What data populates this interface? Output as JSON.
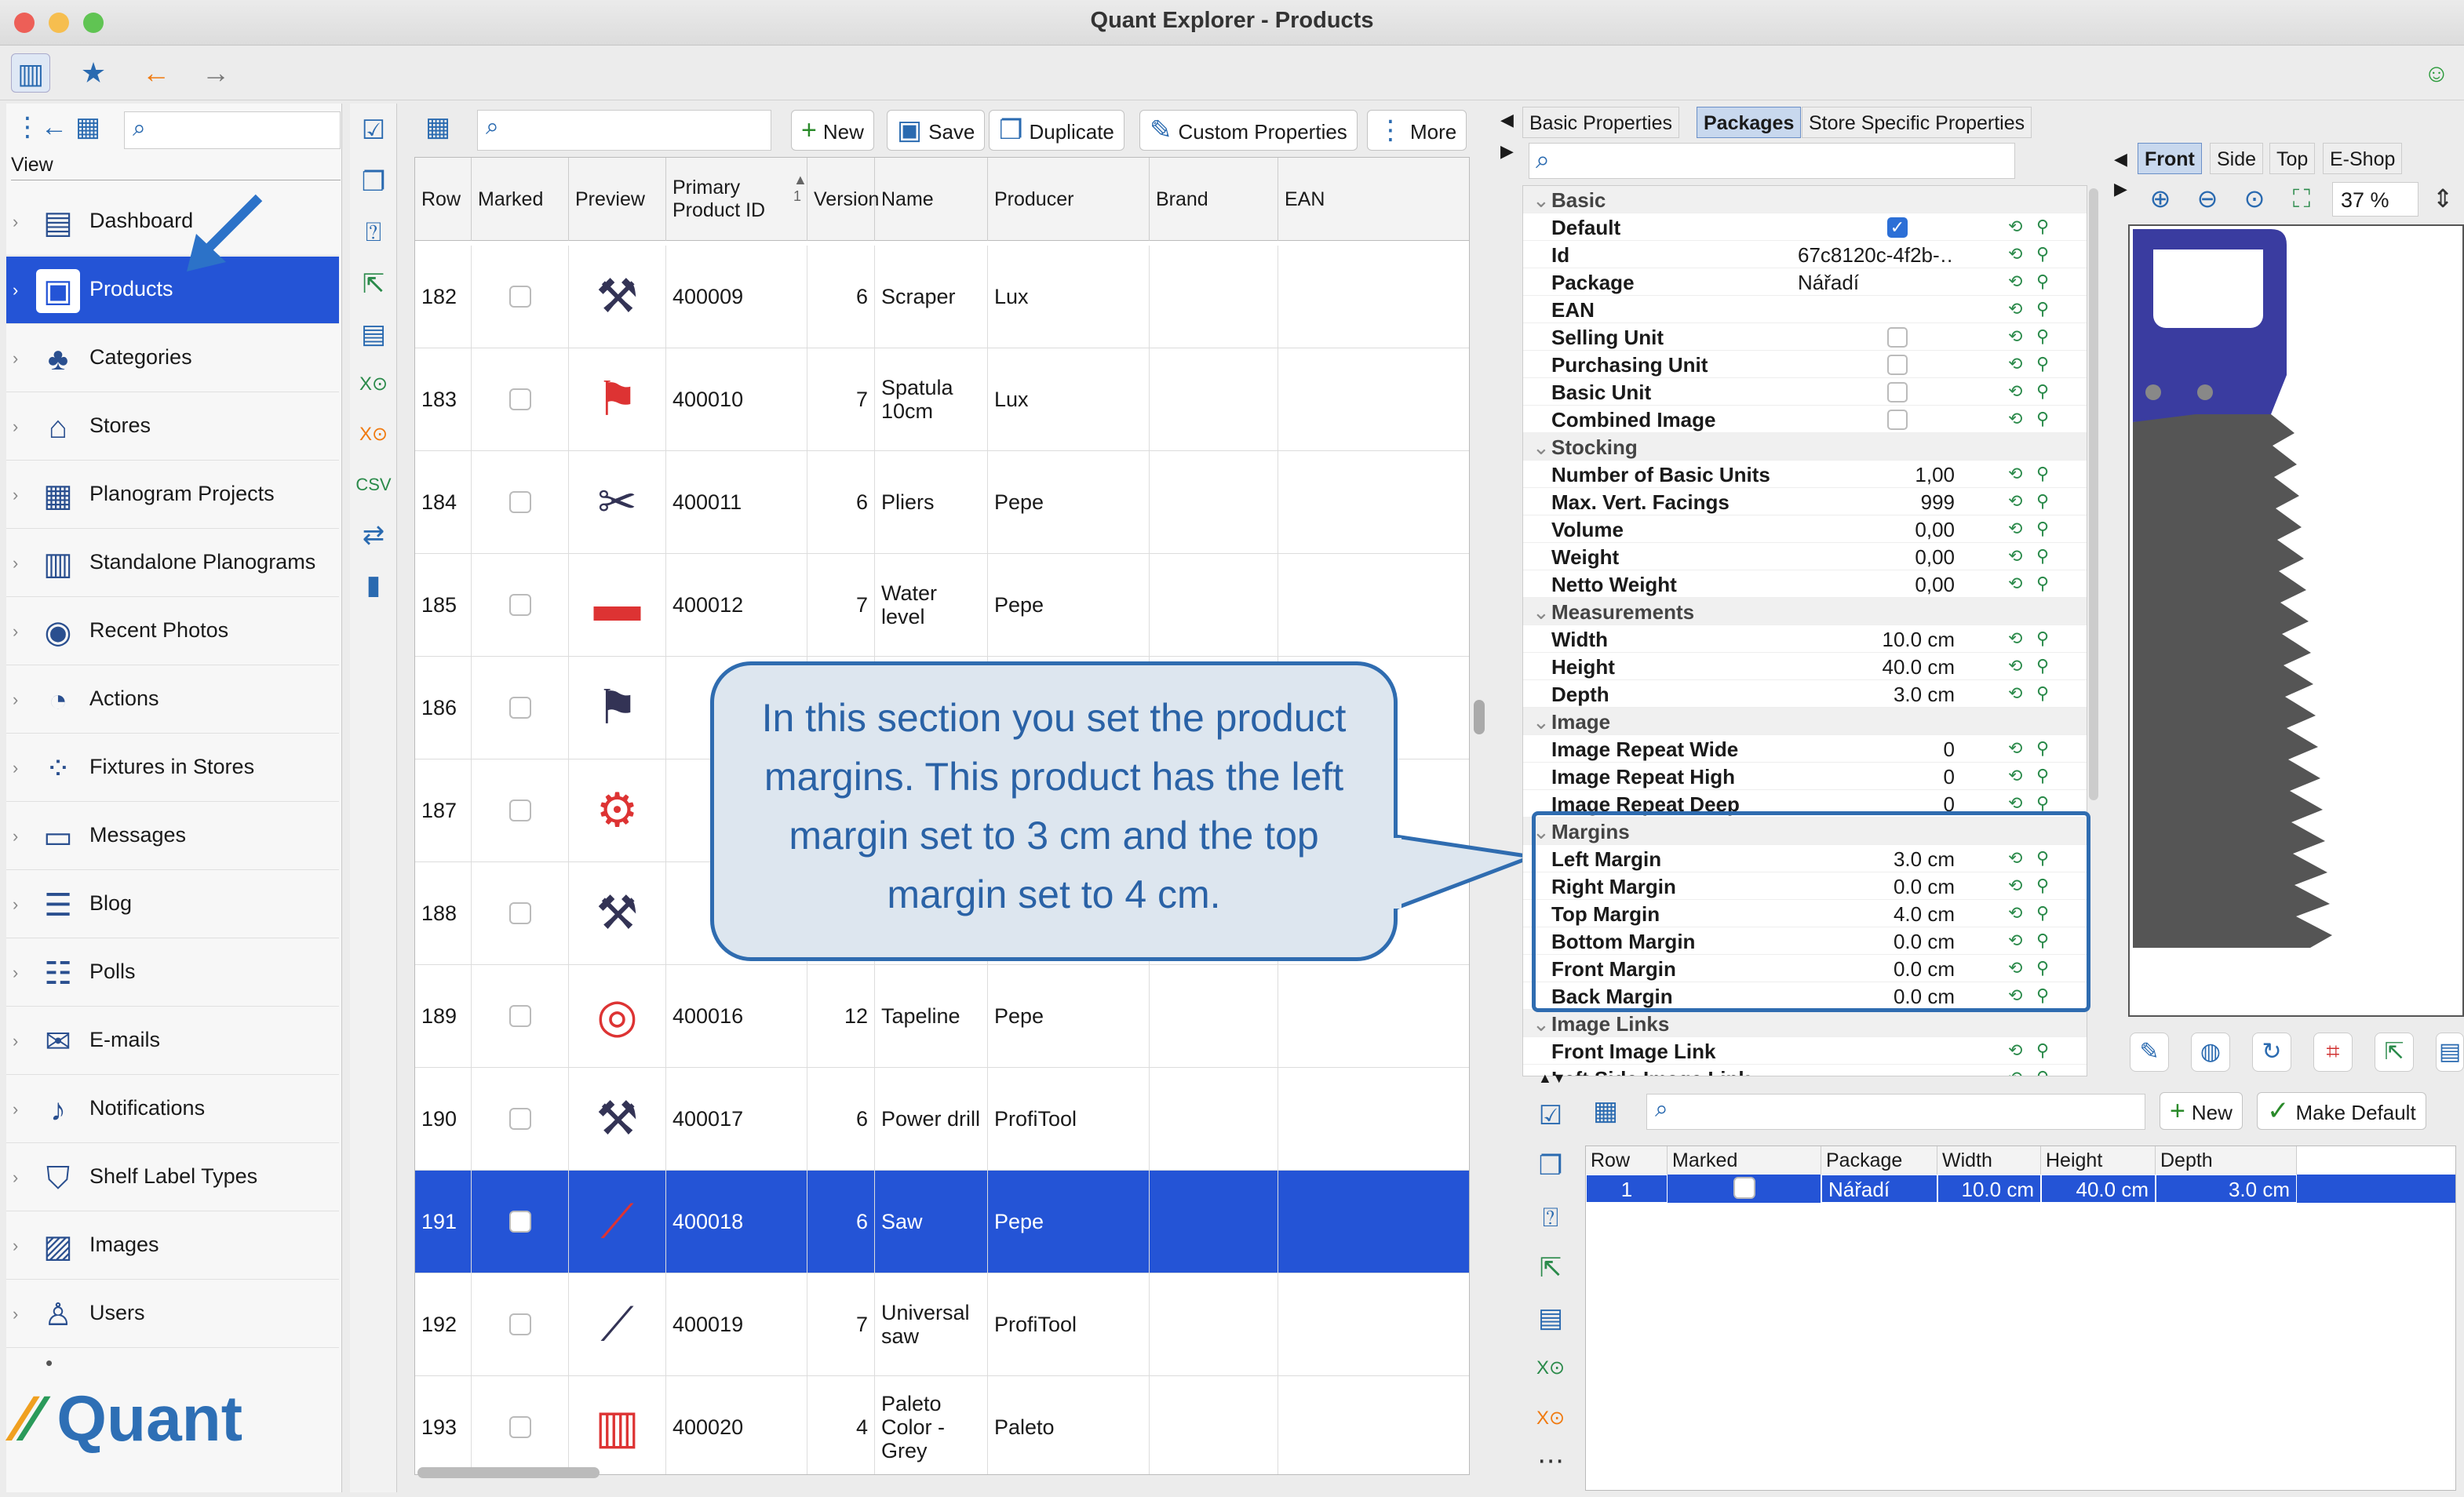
{
  "window": {
    "title": "Quant Explorer - Products"
  },
  "colors": {
    "accent": "#2454d6",
    "callout_border": "#2f6cb0",
    "callout_text": "#2a62a6"
  },
  "toolbar": {
    "icons": [
      "sidebar-toggle-icon",
      "star-icon",
      "back-arrow-icon",
      "forward-arrow-icon"
    ],
    "status_icon": "smiley-icon"
  },
  "sidebar": {
    "view_label": "View",
    "items": [
      {
        "label": "Dashboard",
        "icon": "dashboard-icon"
      },
      {
        "label": "Products",
        "icon": "products-icon",
        "selected": true
      },
      {
        "label": "Categories",
        "icon": "categories-icon"
      },
      {
        "label": "Stores",
        "icon": "stores-icon"
      },
      {
        "label": "Planogram Projects",
        "icon": "planogram-projects-icon"
      },
      {
        "label": "Standalone Planograms",
        "icon": "standalone-planograms-icon"
      },
      {
        "label": "Recent Photos",
        "icon": "camera-icon"
      },
      {
        "label": "Actions",
        "icon": "clock-icon"
      },
      {
        "label": "Fixtures in Stores",
        "icon": "fixtures-icon"
      },
      {
        "label": "Messages",
        "icon": "messages-icon"
      },
      {
        "label": "Blog",
        "icon": "blog-icon"
      },
      {
        "label": "Polls",
        "icon": "polls-icon"
      },
      {
        "label": "E-mails",
        "icon": "mail-icon"
      },
      {
        "label": "Notifications",
        "icon": "bell-icon"
      },
      {
        "label": "Shelf Label Types",
        "icon": "shelf-label-icon"
      },
      {
        "label": "Images",
        "icon": "images-icon"
      },
      {
        "label": "Users",
        "icon": "users-icon"
      }
    ],
    "logo_text": "Quant"
  },
  "products_toolbar": {
    "new": "New",
    "save": "Save",
    "duplicate": "Duplicate",
    "custom_properties": "Custom Properties",
    "more": "More"
  },
  "grid": {
    "columns": [
      "Row",
      "Marked",
      "Preview",
      "Primary Product ID",
      "Version",
      "Name",
      "Producer",
      "Brand",
      "EAN"
    ],
    "sort_indicator": "1",
    "rows": [
      {
        "row": "182",
        "id": "400009",
        "version": "6",
        "name": "Scraper",
        "producer": "Lux"
      },
      {
        "row": "183",
        "id": "400010",
        "version": "7",
        "name": "Spatula 10cm",
        "producer": "Lux"
      },
      {
        "row": "184",
        "id": "400011",
        "version": "6",
        "name": "Pliers",
        "producer": "Pepe"
      },
      {
        "row": "185",
        "id": "400012",
        "version": "7",
        "name": "Water level",
        "producer": "Pepe"
      },
      {
        "row": "186",
        "id": "",
        "version": "",
        "name": "",
        "producer": ""
      },
      {
        "row": "187",
        "id": "",
        "version": "",
        "name": "",
        "producer": ""
      },
      {
        "row": "188",
        "id": "",
        "version": "",
        "name": "",
        "producer": ""
      },
      {
        "row": "189",
        "id": "400016",
        "version": "12",
        "name": "Tapeline",
        "producer": "Pepe"
      },
      {
        "row": "190",
        "id": "400017",
        "version": "6",
        "name": "Power drill",
        "producer": "ProfiTool"
      },
      {
        "row": "191",
        "id": "400018",
        "version": "6",
        "name": "Saw",
        "producer": "Pepe",
        "selected": true
      },
      {
        "row": "192",
        "id": "400019",
        "version": "7",
        "name": "Universal saw",
        "producer": "ProfiTool"
      },
      {
        "row": "193",
        "id": "400020",
        "version": "4",
        "name": "Paleto Color - Grey",
        "producer": "Paleto"
      }
    ]
  },
  "callout": {
    "text": "In this section you set the product margins. This product has the left margin set to 3 cm and the top margin set to 4 cm."
  },
  "right_tabs": [
    "Basic Properties",
    "Packages",
    "Store Specific Properties"
  ],
  "view_tabs": [
    "Front",
    "Side",
    "Top",
    "E-Shop"
  ],
  "zoom": "37 %",
  "properties": [
    {
      "group": "Basic"
    },
    {
      "name": "Default",
      "check": "on"
    },
    {
      "name": "Id",
      "value": "67c8120c-4f2b-…",
      "left": true
    },
    {
      "name": "Package",
      "value": "Nářadí",
      "left": true
    },
    {
      "name": "EAN",
      "value": ""
    },
    {
      "name": "Selling Unit",
      "check": "off"
    },
    {
      "name": "Purchasing Unit",
      "check": "off"
    },
    {
      "name": "Basic Unit",
      "check": "off"
    },
    {
      "name": "Combined Image",
      "check": "off"
    },
    {
      "group": "Stocking"
    },
    {
      "name": "Number of Basic Units",
      "value": "1,00"
    },
    {
      "name": "Max. Vert. Facings",
      "value": "999"
    },
    {
      "name": "Volume",
      "value": "0,00"
    },
    {
      "name": "Weight",
      "value": "0,00"
    },
    {
      "name": "Netto Weight",
      "value": "0,00"
    },
    {
      "group": "Measurements"
    },
    {
      "name": "Width",
      "value": "10.0 cm"
    },
    {
      "name": "Height",
      "value": "40.0 cm"
    },
    {
      "name": "Depth",
      "value": "3.0 cm"
    },
    {
      "group": "Image"
    },
    {
      "name": "Image Repeat Wide",
      "value": "0"
    },
    {
      "name": "Image Repeat High",
      "value": "0"
    },
    {
      "name": "Image Repeat Deep",
      "value": "0"
    },
    {
      "group": "Margins"
    },
    {
      "name": "Left Margin",
      "value": "3.0 cm"
    },
    {
      "name": "Right Margin",
      "value": "0.0 cm"
    },
    {
      "name": "Top Margin",
      "value": "4.0 cm"
    },
    {
      "name": "Bottom Margin",
      "value": "0.0 cm"
    },
    {
      "name": "Front Margin",
      "value": "0.0 cm"
    },
    {
      "name": "Back Margin",
      "value": "0.0 cm"
    },
    {
      "group": "Image Links"
    },
    {
      "name": "Front Image Link",
      "value": ""
    },
    {
      "name": "Left Side Image Link",
      "value": ""
    }
  ],
  "packages": {
    "new": "New",
    "make_default": "Make Default",
    "columns": [
      "Row",
      "Marked",
      "Package",
      "Width",
      "Height",
      "Depth"
    ],
    "rows": [
      {
        "row": "1",
        "package": "Nářadí",
        "width": "10.0 cm",
        "height": "40.0 cm",
        "depth": "3.0 cm"
      }
    ]
  }
}
